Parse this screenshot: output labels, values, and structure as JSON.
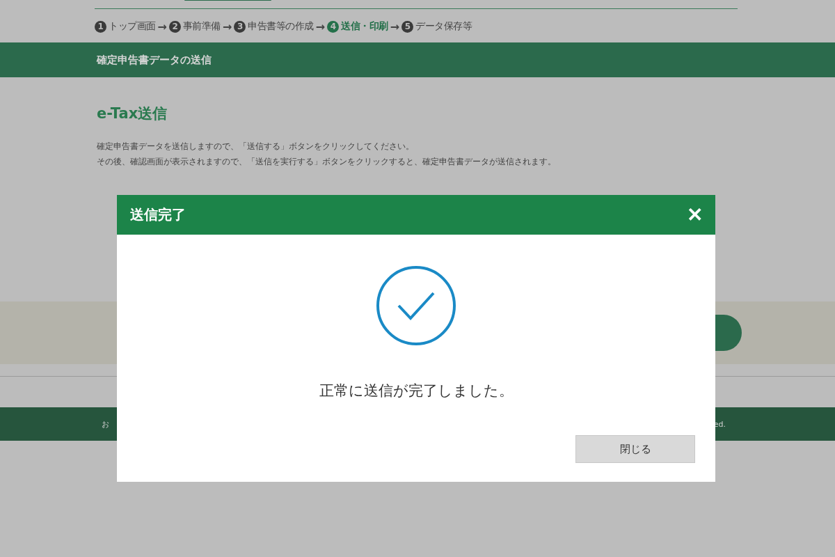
{
  "steps": [
    {
      "number": "1",
      "label": "トップ画面",
      "selected": false
    },
    {
      "number": "2",
      "label": "事前準備",
      "selected": false
    },
    {
      "number": "3",
      "label": "申告書等の作成",
      "selected": false
    },
    {
      "number": "4",
      "label": "送信・印刷",
      "selected": true
    },
    {
      "number": "5",
      "label": "データ保存等",
      "selected": false
    }
  ],
  "step_separator": "→",
  "section_bar": {
    "title": "確定申告書データの送信"
  },
  "heading": "e-Tax送信",
  "paragraphs": [
    "確定申告書データを送信しますので、「送信する」ボタンをクリックしてください。",
    "その後、確認画面が表示されますので、「送信を実行する」ボタンをクリックすると、確定申告書データが送信されます。"
  ],
  "footer": {
    "left_text": "お",
    "right_text": "ed."
  },
  "dialog": {
    "title": "送信完了",
    "close_glyph": "✕",
    "message": "正常に送信が完了しました。",
    "button": "閉じる"
  }
}
